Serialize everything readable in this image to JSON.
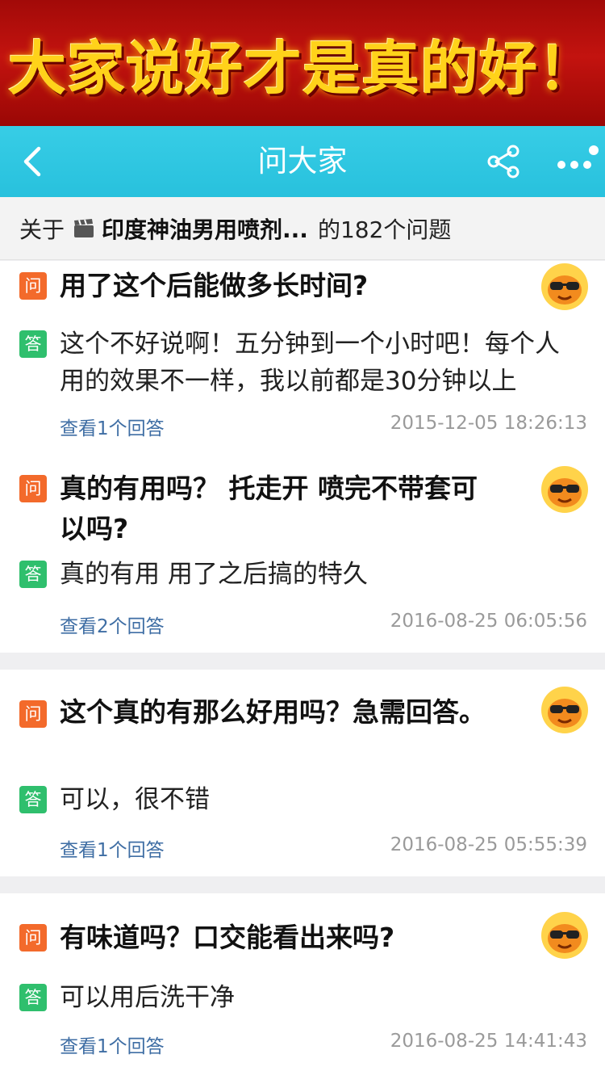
{
  "banner": {
    "text": "大家说好才是真的好！"
  },
  "navbar": {
    "title": "问大家"
  },
  "subheader": {
    "prefix": "关于",
    "product": "印度神油男用喷剂...",
    "count_text": "的182个问题"
  },
  "badges": {
    "question": "问",
    "answer": "答"
  },
  "questions": [
    {
      "question": "用了这个后能做多长时间?",
      "answer": "这个不好说啊！五分钟到一个小时吧！每个人用的效果不一样，我以前都是30分钟以上",
      "view_link": "查看1个回答",
      "time": "2015-12-05 18:26:13"
    },
    {
      "question": "真的有用吗？ 托走开 喷完不带套可以吗?",
      "answer": "真的有用 用了之后搞的特久",
      "view_link": "查看2个回答",
      "time": "2016-08-25 06:05:56"
    },
    {
      "question": "这个真的有那么好用吗？急需回答。",
      "answer": "可以，很不错",
      "view_link": "查看1个回答",
      "time": "2016-08-25 05:55:39"
    },
    {
      "question": "有味道吗？口交能看出来吗?",
      "answer": "可以用后洗干净",
      "view_link": "查看1个回答",
      "time": "2016-08-25 14:41:43"
    }
  ],
  "colors": {
    "navbar": "#2ec6e0",
    "question_badge": "#f36a2b",
    "answer_badge": "#2fbf6d",
    "link": "#3f6ea4",
    "banner": "#b50f0c"
  },
  "icons": {
    "back": "chevron-left-icon",
    "share": "share-icon",
    "more": "more-dots-icon",
    "product": "clapperboard-icon",
    "avatar": "sunglasses-avatar"
  }
}
